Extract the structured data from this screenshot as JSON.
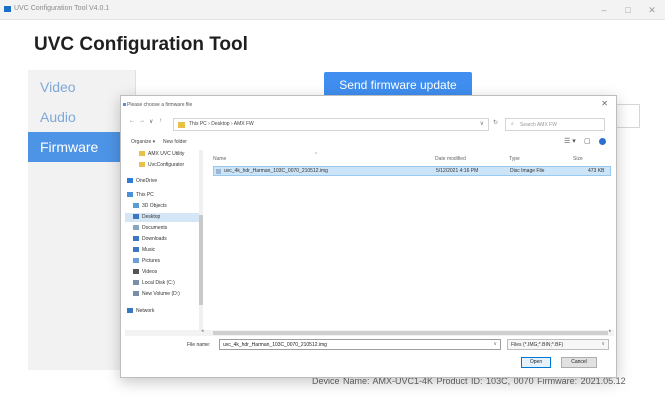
{
  "window": {
    "title": "UVC Configuration Tool V4.0.1",
    "controls": [
      "–",
      "□",
      "✕"
    ]
  },
  "app": {
    "heading": "UVC Configuration Tool",
    "nav": [
      {
        "label": "Video",
        "active": false
      },
      {
        "label": "Audio",
        "active": false
      },
      {
        "label": "Firmware",
        "active": true
      }
    ],
    "send_button": "Send firmware update",
    "footer": "Device Name: AMX-UVC1-4K   Product ID: 103C, 0070   Firmware: 2021.05.12"
  },
  "dialog": {
    "title": "Please choose a firmware file",
    "close": "✕",
    "nav_arrows": [
      "←",
      "→",
      "∨",
      "↑"
    ],
    "address_path": "This PC  ›  Desktop  ›  AMX FW",
    "address_dropdown": "∨",
    "refresh": "↻",
    "search_placeholder": "Search AMX FW",
    "search_icon": "⌕",
    "toolbar": {
      "organize": "Organize ▾",
      "new_folder": "New folder",
      "view": "☰ ▾",
      "pane": "▢"
    },
    "nav_pane": [
      {
        "label": "AMX UVC Utility",
        "icon": "folder",
        "color": "#e8c14a"
      },
      {
        "label": "UvcConfigurator",
        "icon": "folder",
        "color": "#e8c14a"
      },
      {
        "label": "OneDrive",
        "icon": "cloud",
        "color": "#2f7bd8"
      },
      {
        "label": "This PC",
        "icon": "computer",
        "color": "#4a90d9"
      },
      {
        "label": "3D Objects",
        "icon": "cube",
        "color": "#5b9bd5"
      },
      {
        "label": "Desktop",
        "icon": "desktop",
        "color": "#3b78c4",
        "selected": true
      },
      {
        "label": "Documents",
        "icon": "documents",
        "color": "#8aa4c2"
      },
      {
        "label": "Downloads",
        "icon": "download",
        "color": "#3b78c4"
      },
      {
        "label": "Music",
        "icon": "music",
        "color": "#3b78c4"
      },
      {
        "label": "Pictures",
        "icon": "pictures",
        "color": "#6a9fd8"
      },
      {
        "label": "Videos",
        "icon": "videos",
        "color": "#555555"
      },
      {
        "label": "Local Disk (C:)",
        "icon": "drive",
        "color": "#7a8fa6"
      },
      {
        "label": "New Volume (D:)",
        "icon": "drive",
        "color": "#7a8fa6"
      },
      {
        "label": "Network",
        "icon": "network",
        "color": "#3b78c4"
      }
    ],
    "columns": [
      "Name",
      "Date modified",
      "Type",
      "Size"
    ],
    "sort_indicator": "^",
    "files": [
      {
        "name": "uvc_4k_hdr_Harman_103C_0070_210512.img",
        "date": "5/12/2021 4:16 PM",
        "type": "Disc Image File",
        "size": "473 KB"
      }
    ],
    "scroll_arrows": [
      "◂",
      "▸"
    ],
    "file_name_label": "File name:",
    "file_name_value": "uvc_4k_hdr_Harman_103C_0070_210512.img",
    "filter_value": "Files (*.IMG;*.BIN;*.BF)",
    "dropdown_arrow": "∨",
    "open_button": "Open",
    "cancel_button": "Cancel"
  },
  "colors": {
    "accent": "#3f8ef0",
    "nav_active": "#4e94e6",
    "nav_text": "#7ea8d8",
    "selection": "#cce4f7"
  }
}
